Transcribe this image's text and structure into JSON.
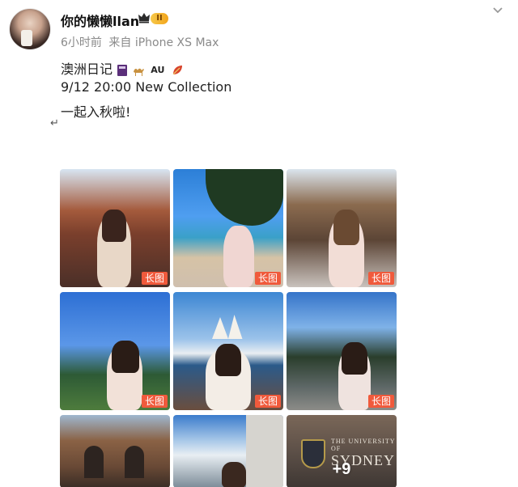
{
  "user": {
    "name": "你的懒懒llan",
    "vip_level": "II",
    "time": "6小时前",
    "source": "来自 iPhone XS Max"
  },
  "post": {
    "line1_text": "澳洲日记",
    "line1_au": "AU",
    "line2": "9/12 20:00 New Collection",
    "line3": "一起入秋啦!"
  },
  "images": {
    "long_tag": "长图",
    "more_count": "+9",
    "last_caption_small": "THE UNIVERSITY OF",
    "last_caption_big": "SYDNEY"
  },
  "colors": {
    "tag": "#f05a3c",
    "vip": "#f2a51c",
    "meta": "#8a8a8a"
  },
  "icons": [
    "crown-icon",
    "more-chevron-icon",
    "notebook-emoji",
    "camel-emoji",
    "leaf-emoji"
  ]
}
